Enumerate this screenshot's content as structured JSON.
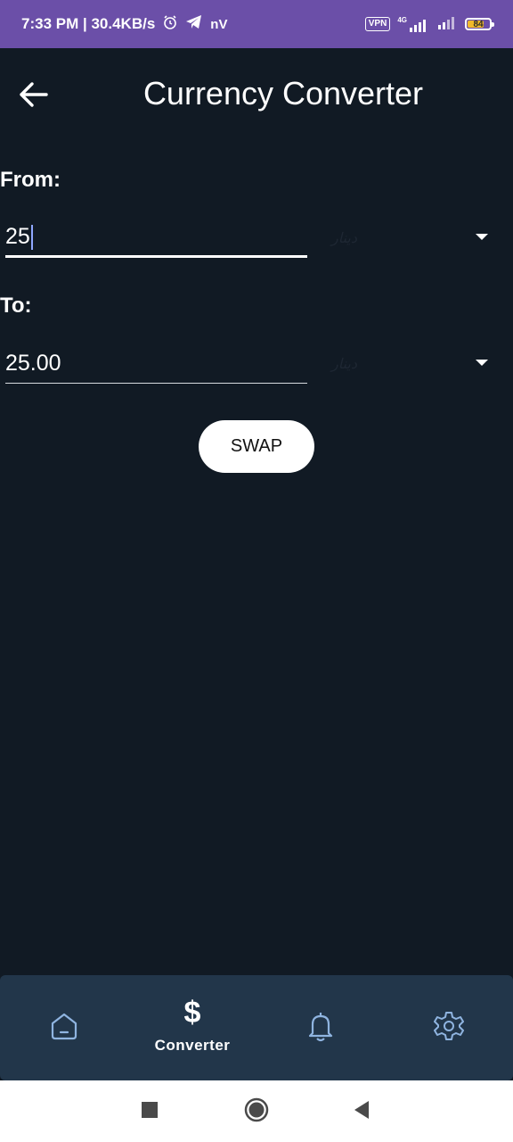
{
  "status_bar": {
    "time_speed": "7:33 PM | 30.4KB/s",
    "net_glyph": "nV",
    "vpn": "VPN",
    "network": "4G",
    "battery": "84",
    "battery_level": 0.84,
    "icons": [
      "alarm-icon",
      "telegram-icon",
      "signal-icon",
      "signal-icon"
    ]
  },
  "app_bar": {
    "title": "Currency Converter",
    "back_icon": "arrow-left-icon"
  },
  "from": {
    "label": "From:",
    "amount": "25",
    "currency": "دينار"
  },
  "to": {
    "label": "To:",
    "amount": "25.00",
    "currency": "دينار"
  },
  "swap_label": "SWAP",
  "bottom_nav": {
    "items": [
      {
        "icon": "home-icon",
        "label": ""
      },
      {
        "icon": "dollar-icon",
        "glyph": "$",
        "label": "Converter",
        "active": true
      },
      {
        "icon": "bell-icon",
        "label": ""
      },
      {
        "icon": "gear-icon",
        "label": ""
      }
    ]
  },
  "colors": {
    "status_bar": "#6b4fa8",
    "background": "#111a24",
    "bottom_nav": "#22364a",
    "icon_inactive": "#8fb4e0"
  }
}
